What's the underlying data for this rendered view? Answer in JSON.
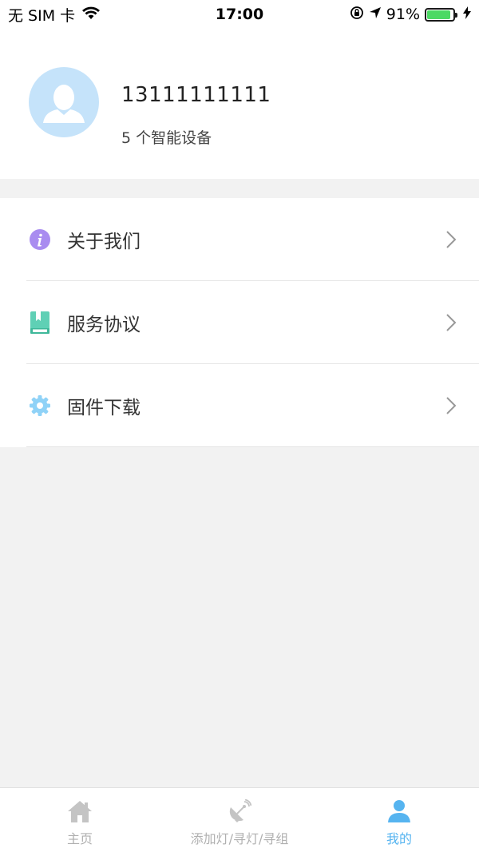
{
  "status_bar": {
    "carrier": "无 SIM 卡",
    "time": "17:00",
    "battery_percent_text": "91%",
    "battery_level": 0.91
  },
  "profile": {
    "username": "13111111111",
    "device_count": "5 个智能设备"
  },
  "menu": {
    "items": [
      {
        "label": "关于我们",
        "icon": "info-icon",
        "color": "#a98cf0"
      },
      {
        "label": "服务协议",
        "icon": "book-icon",
        "color": "#5fd0b5"
      },
      {
        "label": "固件下载",
        "icon": "gear-icon",
        "color": "#8fd2f7"
      }
    ]
  },
  "tab_bar": {
    "tabs": [
      {
        "label": "主页",
        "icon": "home-icon",
        "active": false
      },
      {
        "label": "添加灯/寻灯/寻组",
        "icon": "satellite-dish-icon",
        "active": false
      },
      {
        "label": "我的",
        "icon": "user-icon",
        "active": true
      }
    ]
  },
  "colors": {
    "accent": "#56b4f0",
    "inactive": "#b0b0b0",
    "avatar_bg": "#c5e3fa",
    "battery_fill": "#4cd964"
  }
}
